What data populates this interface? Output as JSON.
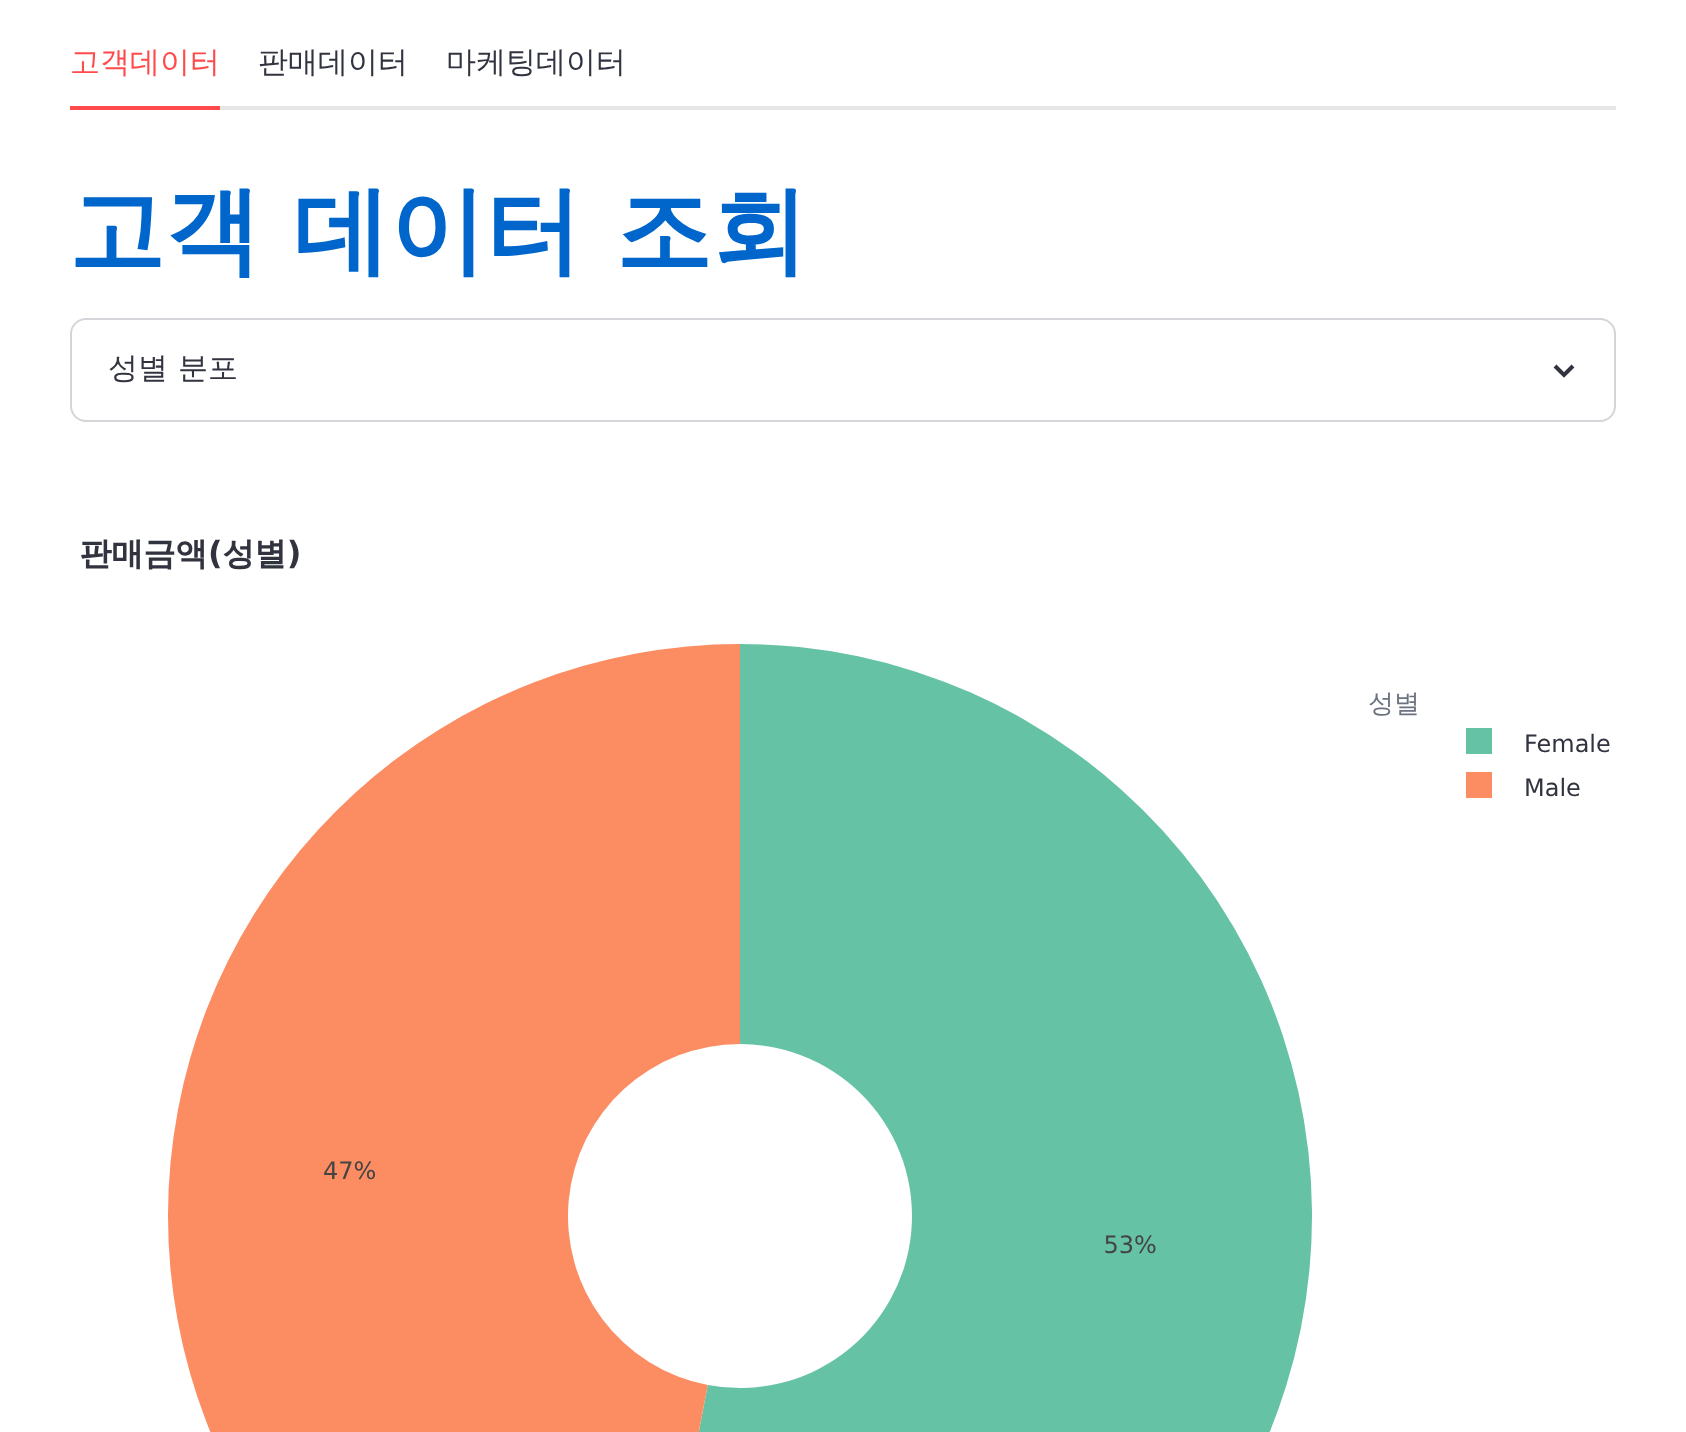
{
  "tabs": [
    {
      "label": "고객데이터",
      "selected": true
    },
    {
      "label": "판매데이터",
      "selected": false
    },
    {
      "label": "마케팅데이터",
      "selected": false
    }
  ],
  "title": "고객 데이터 조회",
  "select": {
    "value": "성별 분포"
  },
  "chart": {
    "chart_data": {
      "type": "donut",
      "title": "판매금액(성별)",
      "categories": [
        "Female",
        "Male"
      ],
      "series": [
        {
          "values": [
            53,
            47
          ]
        }
      ],
      "legend": {
        "title": "성별"
      },
      "colors": [
        "#66c2a5",
        "#fc8d62"
      ],
      "value_labels": [
        "53%",
        "47%"
      ]
    }
  }
}
